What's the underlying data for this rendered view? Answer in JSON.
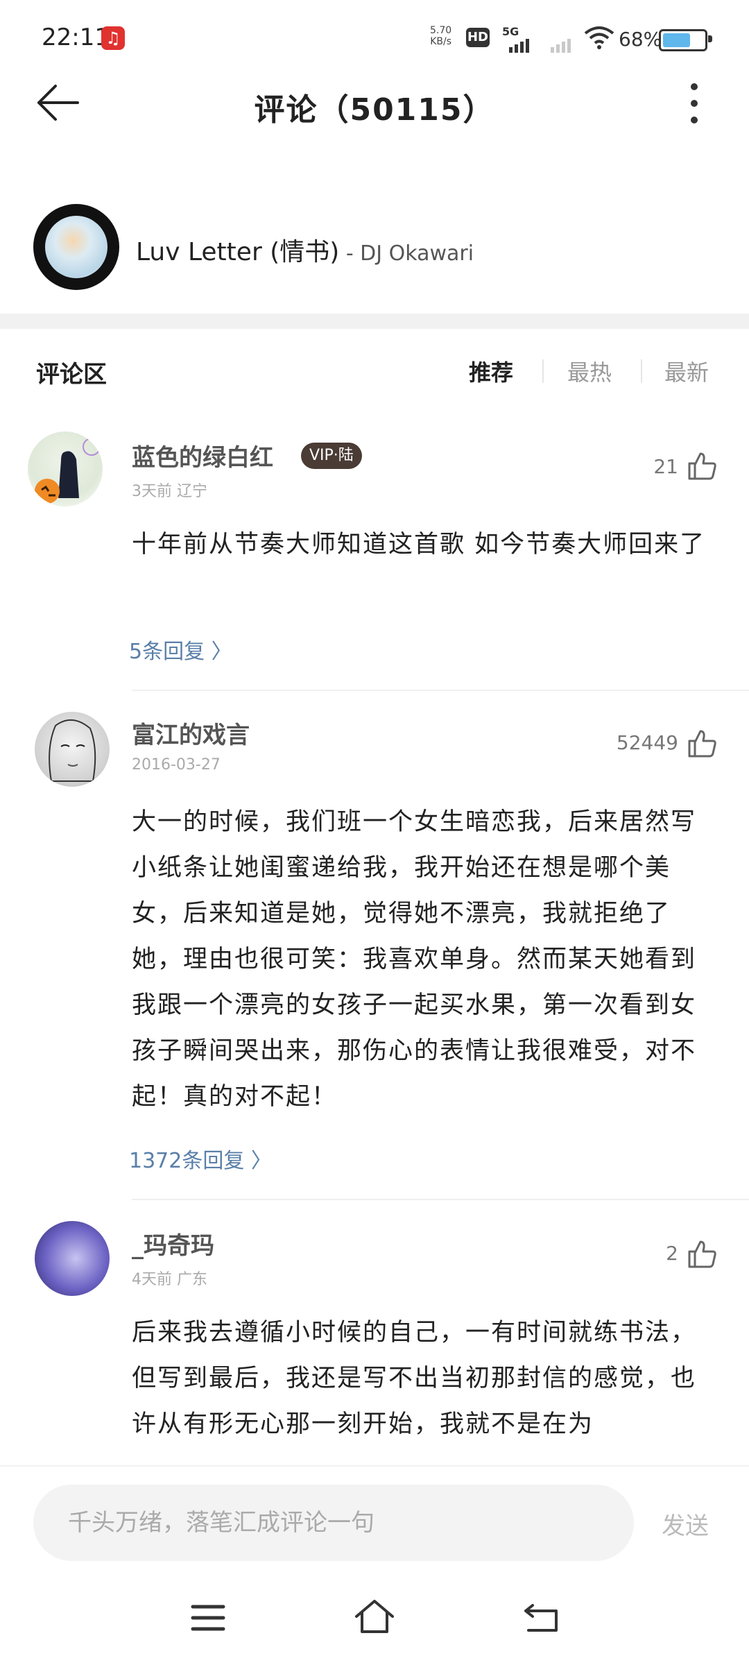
{
  "status_bar": {
    "time": "22:11",
    "net_speed_value": "5.70",
    "net_speed_unit": "KB/s",
    "hd": "HD",
    "network": "5G",
    "battery": "68%",
    "battery_level": 0.68
  },
  "app_bar": {
    "title": "评论（50115）"
  },
  "song": {
    "title": "Luv Letter (情书)",
    "artist": " - DJ Okawari"
  },
  "comments_header": {
    "title": "评论区",
    "tabs": [
      {
        "label": "推荐",
        "active": true
      },
      {
        "label": "最热",
        "active": false
      },
      {
        "label": "最新",
        "active": false
      }
    ]
  },
  "comments": [
    {
      "username": "蓝色的绿白红",
      "badge": "VIP·陆",
      "meta": "3天前 辽宁",
      "likes": "21",
      "text": "十年前从节奏大师知道这首歌 如今节奏大师回来了",
      "replies": "5条回复"
    },
    {
      "username": "富江的戏言",
      "meta": "2016-03-27",
      "likes": "52449",
      "text": "大一的时候，我们班一个女生暗恋我，后来居然写小纸条让她闺蜜递给我，我开始还在想是哪个美女，后来知道是她，觉得她不漂亮，我就拒绝了她，理由也很可笑：我喜欢单身。然而某天她看到我跟一个漂亮的女孩子一起买水果，第一次看到女孩子瞬间哭出来，那伤心的表情让我很难受，对不起！真的对不起！",
      "replies": "1372条回复"
    },
    {
      "username": "_玛奇玛",
      "meta": "4天前 广东",
      "likes": "2",
      "text": "后来我去遵循小时候的自己，一有时间就练书法，但写到最后，我还是写不出当初那封信的感觉，也许从有形无心那一刻开始，我就不是在为"
    }
  ],
  "input": {
    "placeholder": "千头万绪，落笔汇成评论一句",
    "send_label": "发送"
  },
  "nav": {
    "icons": [
      "menu-icon",
      "home-icon",
      "back-icon"
    ]
  }
}
